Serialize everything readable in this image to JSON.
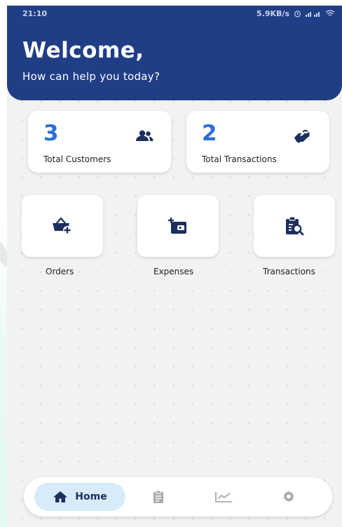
{
  "status_bar": {
    "time": "21:10",
    "speed": "5.9KB/s"
  },
  "header": {
    "title": "Welcome,",
    "subtitle": "How can help you today?"
  },
  "stats": [
    {
      "value": "3",
      "label": "Total Customers",
      "icon": "users-icon"
    },
    {
      "value": "2",
      "label": "Total Transactions",
      "icon": "handshake-icon"
    }
  ],
  "actions": [
    {
      "label": "Orders",
      "icon": "basket-plus-icon"
    },
    {
      "label": "Expenses",
      "icon": "wallet-plus-icon"
    },
    {
      "label": "Transactions",
      "icon": "clipboard-search-icon"
    }
  ],
  "nav": {
    "home_label": "Home",
    "items": [
      "home-icon",
      "clipboard-icon",
      "chart-line-icon",
      "gear-icon"
    ]
  },
  "colors": {
    "header_bg": "#203e86",
    "accent_number": "#2f6fd6",
    "icon_dark": "#1d2f5e",
    "nav_active_bg": "#d7ecf8",
    "page_bg": "#f3f2f0"
  }
}
